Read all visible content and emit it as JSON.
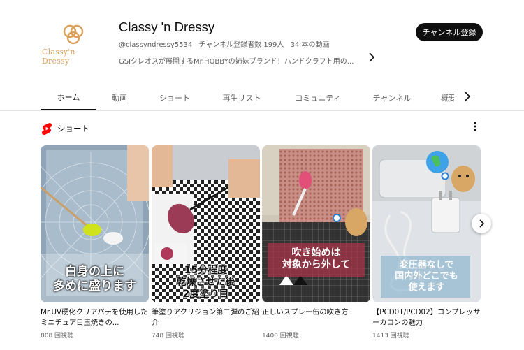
{
  "channel": {
    "avatar_icon": "classy-n-dressy-logo",
    "avatar_wordmark": "Classy'n Dressy",
    "name": "Classy 'n Dressy",
    "handle": "@classyndressy5534",
    "subscribers": "チャンネル登録者数 199人",
    "video_count": "34 本の動画",
    "description": "GSIクレオスが展開するMr.HOBBYの姉妹ブランド！ハンドクラフト用の...",
    "description_more_icon": "chevron-right-icon",
    "subscribe_label": "チャンネル登録",
    "brand_color": "#d9a05b"
  },
  "tabs": {
    "items": [
      {
        "label": "ホーム",
        "active": true
      },
      {
        "label": "動画"
      },
      {
        "label": "ショート"
      },
      {
        "label": "再生リスト"
      },
      {
        "label": "コミュニティ"
      },
      {
        "label": "チャンネル"
      },
      {
        "label": "概要"
      }
    ],
    "scroll_icon": "chevron-right-icon"
  },
  "section": {
    "icon": "shorts-icon",
    "shorts_color": "#ff0000",
    "title": "ショート",
    "menu_icon": "more-vert-icon"
  },
  "shorts": [
    {
      "thumbnail_caption": [
        "白身の上に",
        "多めに盛ります"
      ],
      "title": "Mr.UV硬化クリアパテを使用したミニチュア目玉焼きの...",
      "views": "808 回視聴"
    },
    {
      "thumbnail_caption": [
        "15分程度",
        "乾燥させた後",
        "2度塗り目"
      ],
      "title": "筆塗りアクリジョン第二弾のご紹介",
      "views": "748 回視聴"
    },
    {
      "thumbnail_caption": [
        "吹き始めは",
        "対象から外して"
      ],
      "title": "正しいスプレー缶の吹き方",
      "views": "1400 回視聴"
    },
    {
      "thumbnail_caption": [
        "変圧器なしで",
        "国内外どこでも",
        "使えます"
      ],
      "title": "【PCD01/PCD02】コンプレッサーカロンの魅力",
      "views": "1413 回視聴"
    }
  ],
  "carousel": {
    "next_icon": "chevron-right-icon"
  }
}
